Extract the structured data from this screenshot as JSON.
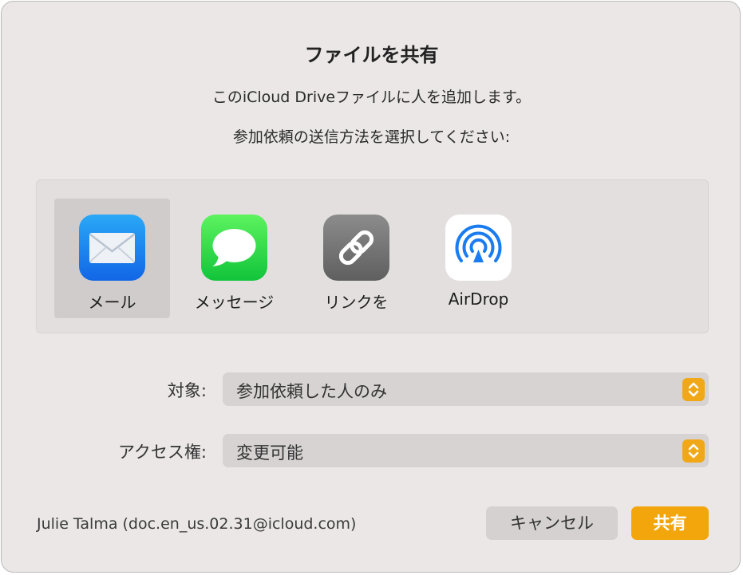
{
  "dialog": {
    "title": "ファイルを共有",
    "description": "このiCloud Driveファイルに人を追加します。",
    "prompt": "参加依頼の送信方法を選択してください:"
  },
  "share_options": [
    {
      "label": "メール",
      "icon": "mail-icon",
      "selected": true
    },
    {
      "label": "メッセージ",
      "icon": "messages-icon",
      "selected": false
    },
    {
      "label": "リンクを",
      "icon": "link-icon",
      "selected": false
    },
    {
      "label": "AirDrop",
      "icon": "airdrop-icon",
      "selected": false
    }
  ],
  "audience": {
    "label": "対象:",
    "value": "参加依頼した人のみ"
  },
  "permission": {
    "label": "アクセス権:",
    "value": "変更可能"
  },
  "account": "Julie Talma (doc.en_us.02.31@icloud.com)",
  "buttons": {
    "cancel": "キャンセル",
    "share": "共有"
  },
  "colors": {
    "accent": "#f2a60c",
    "dialog_background": "#ebe7e7",
    "selected_option": "#d0cccc"
  }
}
